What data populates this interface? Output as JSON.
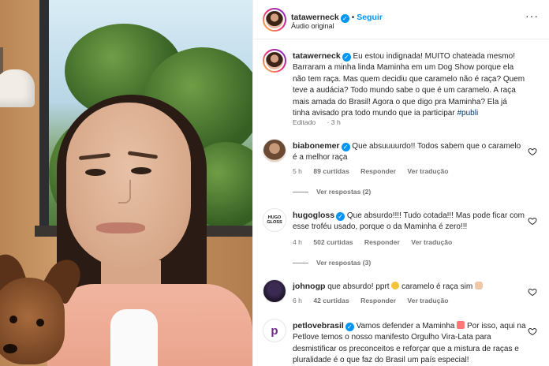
{
  "post": {
    "username": "tatawerneck",
    "separator": "•",
    "follow_label": "Seguir",
    "audio_label": "Áudio original",
    "more_label": "···",
    "caption": "Eu estou indignada! MUITO chateada mesmo! Barraram a minha linda Maminha em um Dog Show porque ela não tem raça. Mas quem decidiu que caramelo não é raça? Quem teve a audácia? Todo mundo sabe o que é um caramelo. A raça mais amada do Brasil! Agora o que digo pra Maminha? Ela já tinha avisado pra todo mundo que ia participar",
    "caption_tag": "#publi",
    "edited_label": "Editado",
    "edited_time": "3 h"
  },
  "comments": [
    {
      "username": "biabonemer",
      "text": "Que absuuuurdo!! Todos sabem que o caramelo é a melhor raça",
      "time": "5 h",
      "likes": "89 curtidas",
      "reply_label": "Responder",
      "translate_label": "Ver tradução",
      "replies_label": "Ver respostas (2)"
    },
    {
      "username": "hugogloss",
      "avatar_text": "HUGO GLOSS",
      "text": "Que absurdo!!!! Tudo cotada!!! Mas pode ficar com esse troféu usado, porque o da Maminha é zero!!!",
      "time": "4 h",
      "likes": "502 curtidas",
      "reply_label": "Responder",
      "translate_label": "Ver tradução",
      "replies_label": "Ver respostas (3)"
    },
    {
      "username": "johnogp",
      "text": "que absurdo! pprt",
      "text_after": "caramelo é raça sim",
      "time": "6 h",
      "likes": "42 curtidas",
      "reply_label": "Responder",
      "translate_label": "Ver tradução"
    },
    {
      "username": "petlovebrasil",
      "avatar_text": "p",
      "text": "Vamos defender a Maminha",
      "text_after": "Por isso, aqui na Petlove temos o nosso manifesto Orgulho Vira-Lata para desmistificar os preconceitos e reforçar que a mistura de raças e pluralidade é o que faz do Brasil um país especial!"
    }
  ],
  "colors": {
    "link_blue": "#0095f6",
    "tag_blue": "#00376b",
    "meta_gray": "#737373"
  }
}
